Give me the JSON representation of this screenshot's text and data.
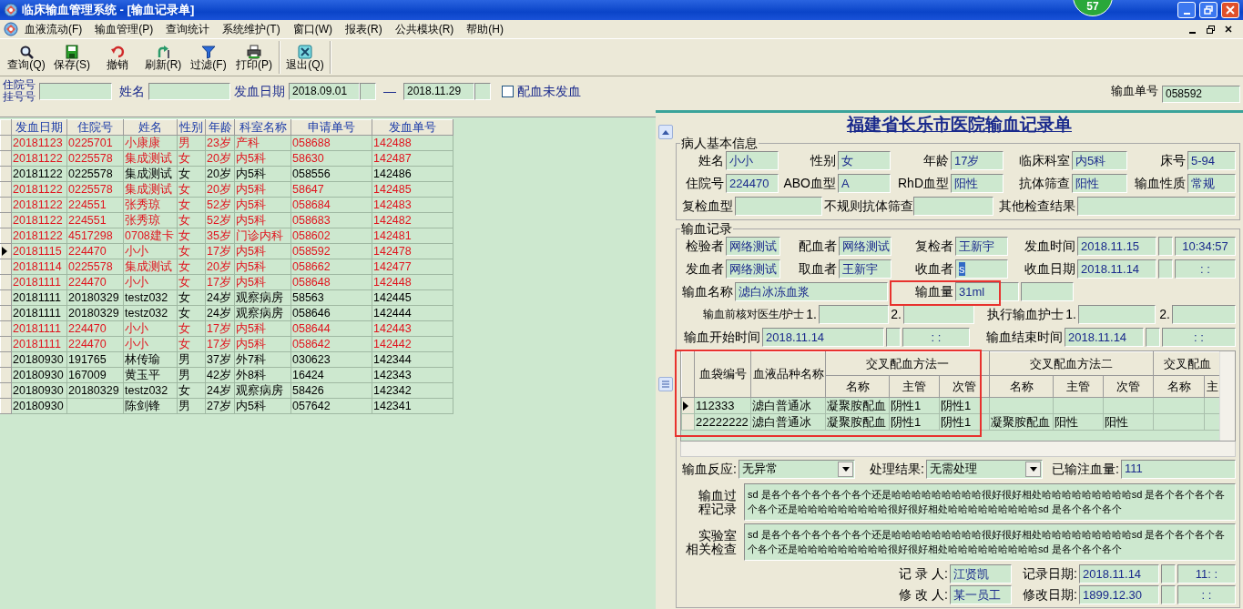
{
  "window": {
    "title": "临床输血管理系统 - [输血记录单]"
  },
  "badge": "57",
  "menu": [
    "血液流动(F)",
    "输血管理(P)",
    "查询统计",
    "系统维护(T)",
    "窗口(W)",
    "报表(R)",
    "公共模块(R)",
    "帮助(H)"
  ],
  "toolbar": [
    {
      "label": "查询(Q)",
      "kind": "search"
    },
    {
      "label": "保存(S)",
      "kind": "save"
    },
    {
      "label": "撤销",
      "kind": "undo"
    },
    {
      "label": "刷新(R)",
      "kind": "refresh"
    },
    {
      "label": "过滤(F)",
      "kind": "filter"
    },
    {
      "label": "打印(P)",
      "kind": "print"
    },
    {
      "label": "退出(Q)",
      "kind": "exit"
    }
  ],
  "filter": {
    "id_labels": [
      "住院号",
      "挂号号"
    ],
    "name_label": "姓名",
    "date_label": "发血日期",
    "date_from": "2018.09.01",
    "dash": "—",
    "date_to": "2018.11.29",
    "unissued": {
      "label": "配血未发血",
      "checked": false
    },
    "order_label": "输血单号",
    "order_value": "058592"
  },
  "grid": {
    "columns": [
      "发血日期",
      "住院号",
      "姓名",
      "性别",
      "年龄",
      "科室名称",
      "申请单号",
      "发血单号"
    ],
    "rows": [
      {
        "selected": false,
        "flagged": true,
        "cells": [
          "20181123",
          "0225701",
          "小康康",
          "男",
          "23岁",
          "产科",
          "058688",
          "142488"
        ]
      },
      {
        "selected": false,
        "flagged": true,
        "cells": [
          "20181122",
          "0225578",
          "集成测试",
          "女",
          "20岁",
          "内5科",
          "58630",
          "142487"
        ]
      },
      {
        "selected": false,
        "flagged": false,
        "cells": [
          "20181122",
          "0225578",
          "集成测试",
          "女",
          "20岁",
          "内5科",
          "058556",
          "142486"
        ]
      },
      {
        "selected": false,
        "flagged": true,
        "cells": [
          "20181122",
          "0225578",
          "集成测试",
          "女",
          "20岁",
          "内5科",
          "58647",
          "142485"
        ]
      },
      {
        "selected": false,
        "flagged": true,
        "cells": [
          "20181122",
          "224551",
          "张秀琼",
          "女",
          "52岁",
          "内5科",
          "058684",
          "142483"
        ]
      },
      {
        "selected": false,
        "flagged": true,
        "cells": [
          "20181122",
          "224551",
          "张秀琼",
          "女",
          "52岁",
          "内5科",
          "058683",
          "142482"
        ]
      },
      {
        "selected": false,
        "flagged": true,
        "cells": [
          "20181122",
          "4517298",
          "0708建卡",
          "女",
          "35岁",
          "门诊内科",
          "058602",
          "142481"
        ]
      },
      {
        "selected": true,
        "flagged": true,
        "cells": [
          "20181115",
          "224470",
          "小小",
          "女",
          "17岁",
          "内5科",
          "058592",
          "142478"
        ]
      },
      {
        "selected": false,
        "flagged": true,
        "cells": [
          "20181114",
          "0225578",
          "集成测试",
          "女",
          "20岁",
          "内5科",
          "058662",
          "142477"
        ]
      },
      {
        "selected": false,
        "flagged": true,
        "cells": [
          "20181111",
          "224470",
          "小小",
          "女",
          "17岁",
          "内5科",
          "058648",
          "142448"
        ]
      },
      {
        "selected": false,
        "flagged": false,
        "cells": [
          "20181111",
          "20180329",
          "testz032",
          "女",
          "24岁",
          "观察病房",
          "58563",
          "142445"
        ]
      },
      {
        "selected": false,
        "flagged": false,
        "cells": [
          "20181111",
          "20180329",
          "testz032",
          "女",
          "24岁",
          "观察病房",
          "058646",
          "142444"
        ]
      },
      {
        "selected": false,
        "flagged": true,
        "cells": [
          "20181111",
          "224470",
          "小小",
          "女",
          "17岁",
          "内5科",
          "058644",
          "142443"
        ]
      },
      {
        "selected": false,
        "flagged": true,
        "cells": [
          "20181111",
          "224470",
          "小小",
          "女",
          "17岁",
          "内5科",
          "058642",
          "142442"
        ]
      },
      {
        "selected": false,
        "flagged": false,
        "cells": [
          "20180930",
          "191765",
          "林传瑜",
          "男",
          "37岁",
          "外7科",
          "030623",
          "142344"
        ]
      },
      {
        "selected": false,
        "flagged": false,
        "cells": [
          "20180930",
          "167009",
          "黄玉平",
          "男",
          "42岁",
          "外8科",
          "16424",
          "142343"
        ]
      },
      {
        "selected": false,
        "flagged": false,
        "cells": [
          "20180930",
          "20180329",
          "testz032",
          "女",
          "24岁",
          "观察病房",
          "58426",
          "142342"
        ]
      },
      {
        "selected": false,
        "flagged": false,
        "cells": [
          "20180930",
          null,
          "陈剑锋",
          "男",
          "27岁",
          "内5科",
          "057642",
          "142341"
        ]
      }
    ]
  },
  "form_title": "福建省长乐市医院输血记录单",
  "patient_info": {
    "title": "病人基本信息",
    "rows": [
      [
        {
          "kind": "label",
          "text": "姓名"
        },
        {
          "kind": "field",
          "value": "小小"
        },
        {
          "kind": "label",
          "text": "性别"
        },
        {
          "kind": "field",
          "value": "女"
        },
        {
          "kind": "label",
          "text": "年龄"
        },
        {
          "kind": "field",
          "value": "17岁"
        },
        {
          "kind": "label",
          "text": "临床科室"
        },
        {
          "kind": "field",
          "value": "内5科"
        },
        {
          "kind": "label",
          "text": "床号"
        },
        {
          "kind": "field",
          "value": "5-94"
        }
      ],
      [
        {
          "kind": "label",
          "text": "住院号"
        },
        {
          "kind": "field",
          "value": "224470"
        },
        {
          "kind": "label",
          "text": "ABO血型"
        },
        {
          "kind": "field",
          "value": "A"
        },
        {
          "kind": "label",
          "text": "RhD血型"
        },
        {
          "kind": "field",
          "value": "阳性"
        },
        {
          "kind": "label",
          "text": "抗体筛查"
        },
        {
          "kind": "field",
          "value": "阳性"
        },
        {
          "kind": "label",
          "text": "输血性质"
        },
        {
          "kind": "field",
          "value": "常规"
        }
      ]
    ],
    "extra_row": [
      {
        "kind": "label",
        "text": "复检血型"
      },
      {
        "kind": "field"
      },
      {
        "kind": "label",
        "text": "不规则抗体筛查"
      },
      {
        "kind": "field"
      },
      {
        "kind": "label",
        "text": "其他检查结果"
      },
      {
        "kind": "field"
      }
    ]
  },
  "record": {
    "title": "输血记录",
    "staff_rows": [
      [
        {
          "kind": "label",
          "text": "检验者"
        },
        {
          "kind": "field",
          "value": "网络测试"
        },
        {
          "kind": "label",
          "text": "配血者"
        },
        {
          "kind": "field",
          "value": "网络测试"
        },
        {
          "kind": "label",
          "text": "复检者"
        },
        {
          "kind": "field",
          "value": "王新宇"
        },
        {
          "kind": "label",
          "text": "发血时间"
        },
        {
          "kind": "date",
          "value": "2018.11.15"
        },
        {
          "kind": "box"
        },
        {
          "kind": "time",
          "value": "10:34:57"
        }
      ],
      [
        {
          "kind": "label",
          "text": "发血者"
        },
        {
          "kind": "field",
          "value": "网络测试"
        },
        {
          "kind": "label",
          "text": "取血者"
        },
        {
          "kind": "field",
          "value": "王新宇"
        },
        {
          "kind": "label",
          "text": "收血者"
        },
        {
          "kind": "field",
          "value": "s",
          "text_selected": true
        },
        {
          "kind": "label",
          "text": "收血日期"
        },
        {
          "kind": "date",
          "value": "2018.11.14"
        },
        {
          "kind": "box"
        },
        {
          "kind": "time",
          "value": ": :"
        }
      ]
    ],
    "product_row": [
      {
        "kind": "label",
        "text": "输血名称"
      },
      {
        "kind": "field",
        "value": "滤白冰冻血浆"
      },
      {
        "kind": "label",
        "text": "输血量"
      },
      {
        "kind": "field",
        "value": "31ml"
      },
      {
        "kind": "field"
      }
    ],
    "check_row": [
      {
        "kind": "label",
        "text": "输血前核对医生/护士"
      },
      {
        "kind": "label",
        "text": "1."
      },
      {
        "kind": "field"
      },
      {
        "kind": "label",
        "text": "2."
      },
      {
        "kind": "field"
      },
      {
        "kind": "label",
        "text": "执行输血护士"
      },
      {
        "kind": "label",
        "text": "1."
      },
      {
        "kind": "field"
      },
      {
        "kind": "label",
        "text": "2."
      },
      {
        "kind": "field"
      }
    ],
    "time_row": [
      {
        "kind": "label",
        "text": "输血开始时间"
      },
      {
        "kind": "date",
        "value": "2018.11.14"
      },
      {
        "kind": "box"
      },
      {
        "kind": "time",
        "value": ": :"
      },
      {
        "kind": "label",
        "text": "输血结束时间"
      },
      {
        "kind": "date",
        "value": "2018.11.14"
      },
      {
        "kind": "box"
      },
      {
        "kind": "time",
        "value": ": :"
      }
    ]
  },
  "crossmatch": {
    "fixed_columns": [
      "血袋编号",
      "血液品种名称"
    ],
    "method_groups": [
      {
        "title": "交叉配血方法一",
        "columns": [
          "名称",
          "主管",
          "次管"
        ]
      },
      {
        "title": "交叉配血方法二",
        "columns": [
          "名称",
          "主管",
          "次管"
        ]
      },
      {
        "title": "交叉配血",
        "columns": [
          "名称",
          "主"
        ]
      }
    ],
    "rows": [
      {
        "selected": true,
        "cells": [
          "112333",
          "滤白普通冰",
          "凝聚胺配血",
          "阴性1",
          "阴性1"
        ]
      },
      {
        "selected": false,
        "cells": [
          "22222222",
          "滤白普通冰",
          "凝聚胺配血",
          "阴性1",
          "阴性1",
          "凝聚胺配血",
          "阳性",
          "阳性"
        ]
      }
    ]
  },
  "outcome": [
    {
      "kind": "label",
      "text": "输血反应:"
    },
    {
      "kind": "select",
      "value": "无异常"
    },
    {
      "kind": "label",
      "text": "处理结果:"
    },
    {
      "kind": "select",
      "value": "无需处理"
    },
    {
      "kind": "label",
      "text": "已输注血量:"
    },
    {
      "kind": "field",
      "value": "111"
    }
  ],
  "notes": [
    {
      "label_lines": [
        "输血过",
        "程记录"
      ],
      "text": "sd 是各个各个各个各个各个还是哈哈哈哈哈哈哈哈哈很好很好相处哈哈哈哈哈哈哈哈哈sd 是各个各个各个各个各个还是哈哈哈哈哈哈哈哈哈很好很好相处哈哈哈哈哈哈哈哈哈sd 是各个各个各个"
    },
    {
      "label_lines": [
        "实验室",
        "相关检查"
      ],
      "text": "sd 是各个各个各个各个各个还是哈哈哈哈哈哈哈哈哈很好很好相处哈哈哈哈哈哈哈哈哈sd 是各个各个各个各个各个还是哈哈哈哈哈哈哈哈哈很好很好相处哈哈哈哈哈哈哈哈哈sd 是各个各个各个"
    }
  ],
  "signoff": [
    [
      {
        "kind": "label",
        "text": "记 录 人:"
      },
      {
        "kind": "field",
        "value": "江贤凯"
      },
      {
        "kind": "label",
        "text": "记录日期:"
      },
      {
        "kind": "date",
        "value": "2018.11.14"
      },
      {
        "kind": "box"
      },
      {
        "kind": "time",
        "value": "11: :"
      }
    ],
    [
      {
        "kind": "label",
        "text": "修 改 人:"
      },
      {
        "kind": "field",
        "value": "某一员工"
      },
      {
        "kind": "label",
        "text": "修改日期:"
      },
      {
        "kind": "date",
        "value": "1899.12.30"
      },
      {
        "kind": "box"
      },
      {
        "kind": "time",
        "value": ": :"
      }
    ]
  ]
}
